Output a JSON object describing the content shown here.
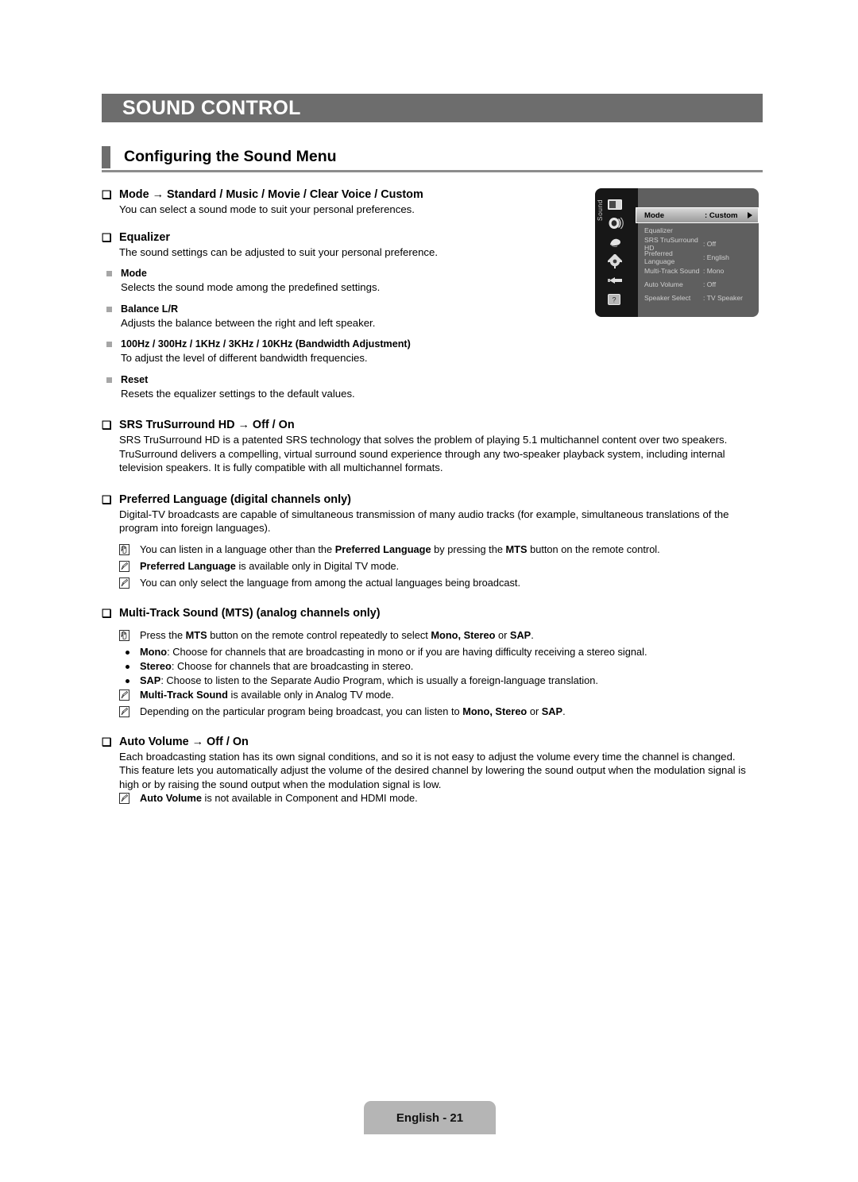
{
  "chapter": {
    "title": "SOUND CONTROL"
  },
  "section": {
    "title": "Configuring the Sound Menu"
  },
  "footer": {
    "page_label": "English - 21"
  },
  "bullets": {
    "checkbox": "❑",
    "arrow": "→"
  },
  "osd": {
    "rail_label": "Sound",
    "rows": [
      {
        "name": "Mode",
        "value": ": Custom",
        "selected": true
      },
      {
        "name": "Equalizer",
        "value": "",
        "selected": false
      },
      {
        "name": "SRS TruSurround HD",
        "value": ": Off",
        "selected": false
      },
      {
        "name": "Preferred Language",
        "value": ": English",
        "selected": false
      },
      {
        "name": "Multi-Track Sound",
        "value": ": Mono",
        "selected": false
      },
      {
        "name": "Auto Volume",
        "value": ": Off",
        "selected": false
      },
      {
        "name": "Speaker Select",
        "value": ": TV Speaker",
        "selected": false
      }
    ],
    "icons": [
      "picture-icon",
      "sound-icon",
      "channel-icon",
      "setup-icon",
      "input-icon",
      "support-icon"
    ]
  },
  "content": {
    "mode": {
      "heading": "Mode → Standard / Music / Movie / Clear Voice / Custom",
      "body": "You can select a sound mode to suit your personal preferences."
    },
    "equalizer": {
      "heading": "Equalizer",
      "body": "The sound settings can be adjusted to suit your personal preference.",
      "sub": [
        {
          "title": "Mode",
          "body": "Selects the sound mode among the predefined settings."
        },
        {
          "title": "Balance L/R",
          "body": "Adjusts the balance between the right and left speaker."
        },
        {
          "title": "100Hz / 300Hz / 1KHz / 3KHz / 10KHz (Bandwidth Adjustment)",
          "body": "To adjust the level of different bandwidth frequencies."
        },
        {
          "title": "Reset",
          "body": "Resets the equalizer settings to the default values."
        }
      ]
    },
    "srs": {
      "heading": "SRS TruSurround HD → Off / On",
      "body": "SRS TruSurround HD is a patented SRS technology that solves the problem of playing 5.1 multichannel content over two speakers. TruSurround delivers a compelling, virtual surround sound experience through any two-speaker playback system, including internal television speakers. It is fully compatible with all multichannel formats."
    },
    "preferred_language": {
      "heading": "Preferred Language (digital channels only)",
      "body": "Digital-TV broadcasts are capable of simultaneous transmission of many audio tracks (for example, simultaneous translations of the program into foreign languages).",
      "notes": [
        {
          "icon": "hand-note-icon",
          "p1": "You can listen in a language other than the ",
          "b1": "Preferred Language",
          "p2": " by pressing the ",
          "b2": "MTS",
          "p3": " button on the remote control."
        },
        {
          "icon": "pencil-note-icon",
          "p1": "",
          "b1": "Preferred Language",
          "p2": " is available only in Digital TV mode.",
          "b2": "",
          "p3": ""
        },
        {
          "icon": "pencil-note-icon",
          "p1": "You can only select the language from among the actual languages being broadcast.",
          "b1": "",
          "p2": "",
          "b2": "",
          "p3": ""
        }
      ]
    },
    "mts": {
      "heading": "Multi-Track Sound (MTS) (analog channels only)",
      "note_press": {
        "icon": "hand-note-icon",
        "p1": "Press the ",
        "b1": "MTS",
        "p2": " button on the remote control repeatedly to select ",
        "b2": "Mono, Stereo",
        "p3": " or ",
        "b3": "SAP",
        "p4": "."
      },
      "dots": [
        {
          "term": "Mono",
          "rest": ": Choose for channels that are broadcasting in mono or if you are having difficulty receiving a stereo signal."
        },
        {
          "term": "Stereo",
          "rest": ": Choose for channels that are broadcasting in stereo."
        },
        {
          "term": "SAP",
          "rest": ": Choose to listen to the Separate Audio Program, which is usually a foreign-language translation."
        }
      ],
      "notes": [
        {
          "icon": "pencil-note-icon",
          "p1": "",
          "b1": "Multi-Track Sound",
          "p2": " is available only in Analog TV mode.",
          "b2": "",
          "p3": "",
          "b3": "",
          "p4": ""
        },
        {
          "icon": "pencil-note-icon",
          "p1": "Depending on the particular program being broadcast, you can listen to ",
          "b1": "Mono, Stereo",
          "p2": " or ",
          "b2": "SAP",
          "p3": ".",
          "b3": "",
          "p4": ""
        }
      ]
    },
    "auto_volume": {
      "heading": "Auto Volume → Off / On",
      "body": "Each broadcasting station has its own signal conditions, and so it is not easy to adjust the volume every time the channel is changed. This feature lets you automatically adjust the volume of the desired channel by lowering the sound output when the modulation signal is high or by raising the sound output when the modulation signal is low.",
      "note": {
        "icon": "pencil-note-icon",
        "b1": "Auto Volume",
        "p2": " is not available in Component and HDMI mode."
      }
    }
  }
}
